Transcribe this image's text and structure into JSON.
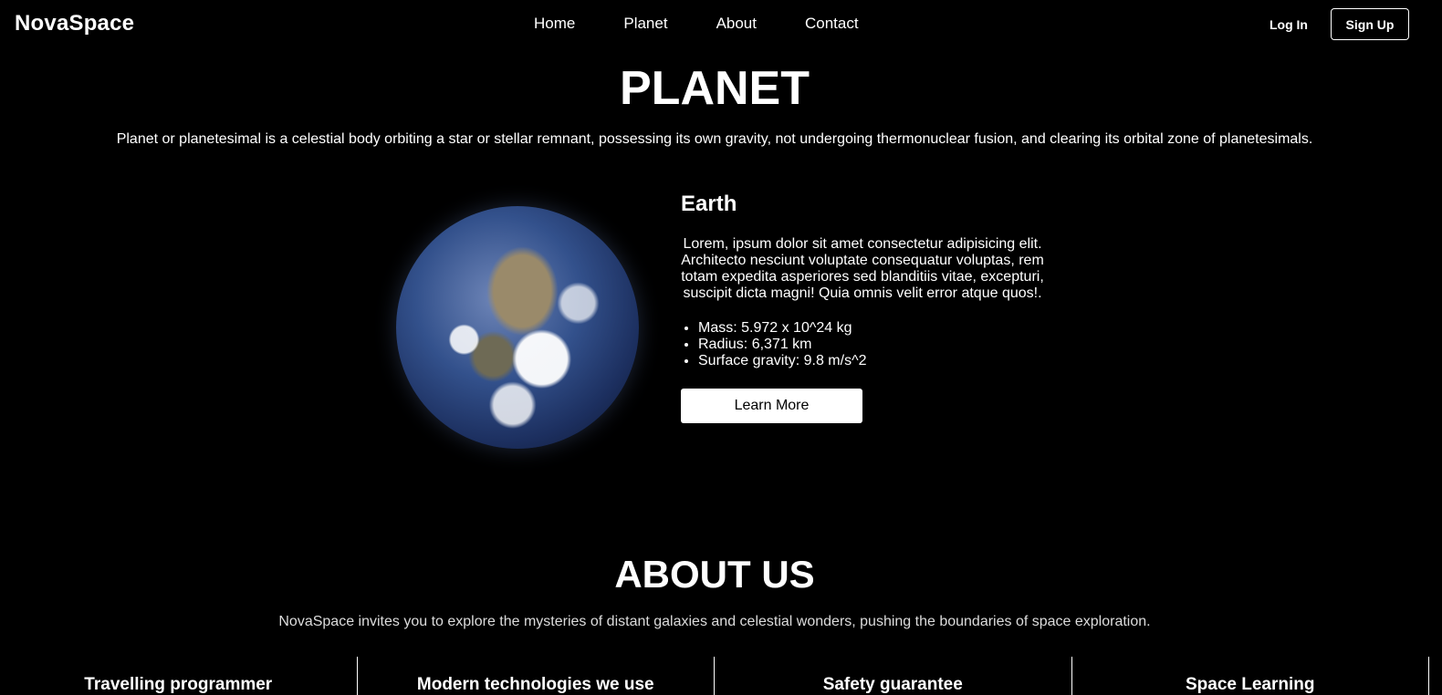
{
  "header": {
    "logo": "NovaSpace",
    "nav": [
      "Home",
      "Planet",
      "About",
      "Contact"
    ],
    "login_label": "Log In",
    "signup_label": "Sign Up"
  },
  "planet_section": {
    "title": "PLANET",
    "description": "Planet or planetesimal is a celestial body orbiting a star or stellar remnant, possessing its own gravity, not undergoing thermonuclear fusion, and clearing its orbital zone of planetesimals.",
    "card": {
      "name": "Earth",
      "text": "Lorem, ipsum dolor sit amet consectetur adipisicing elit. Architecto nesciunt voluptate consequatur voluptas, rem totam expedita asperiores sed blanditiis vitae, excepturi, suscipit dicta magni! Quia omnis velit error atque quos!.",
      "facts": [
        "Mass: 5.972 x 10^24 kg",
        "Radius: 6,371 km",
        "Surface gravity: 9.8 m/s^2"
      ],
      "button_label": "Learn More"
    }
  },
  "about_section": {
    "title": "ABOUT US",
    "description": "NovaSpace invites you to explore the mysteries of distant galaxies and celestial wonders, pushing the boundaries of space exploration.",
    "features": [
      "Travelling programmer",
      "Modern technologies we use",
      "Safety guarantee",
      "Space Learning"
    ]
  }
}
